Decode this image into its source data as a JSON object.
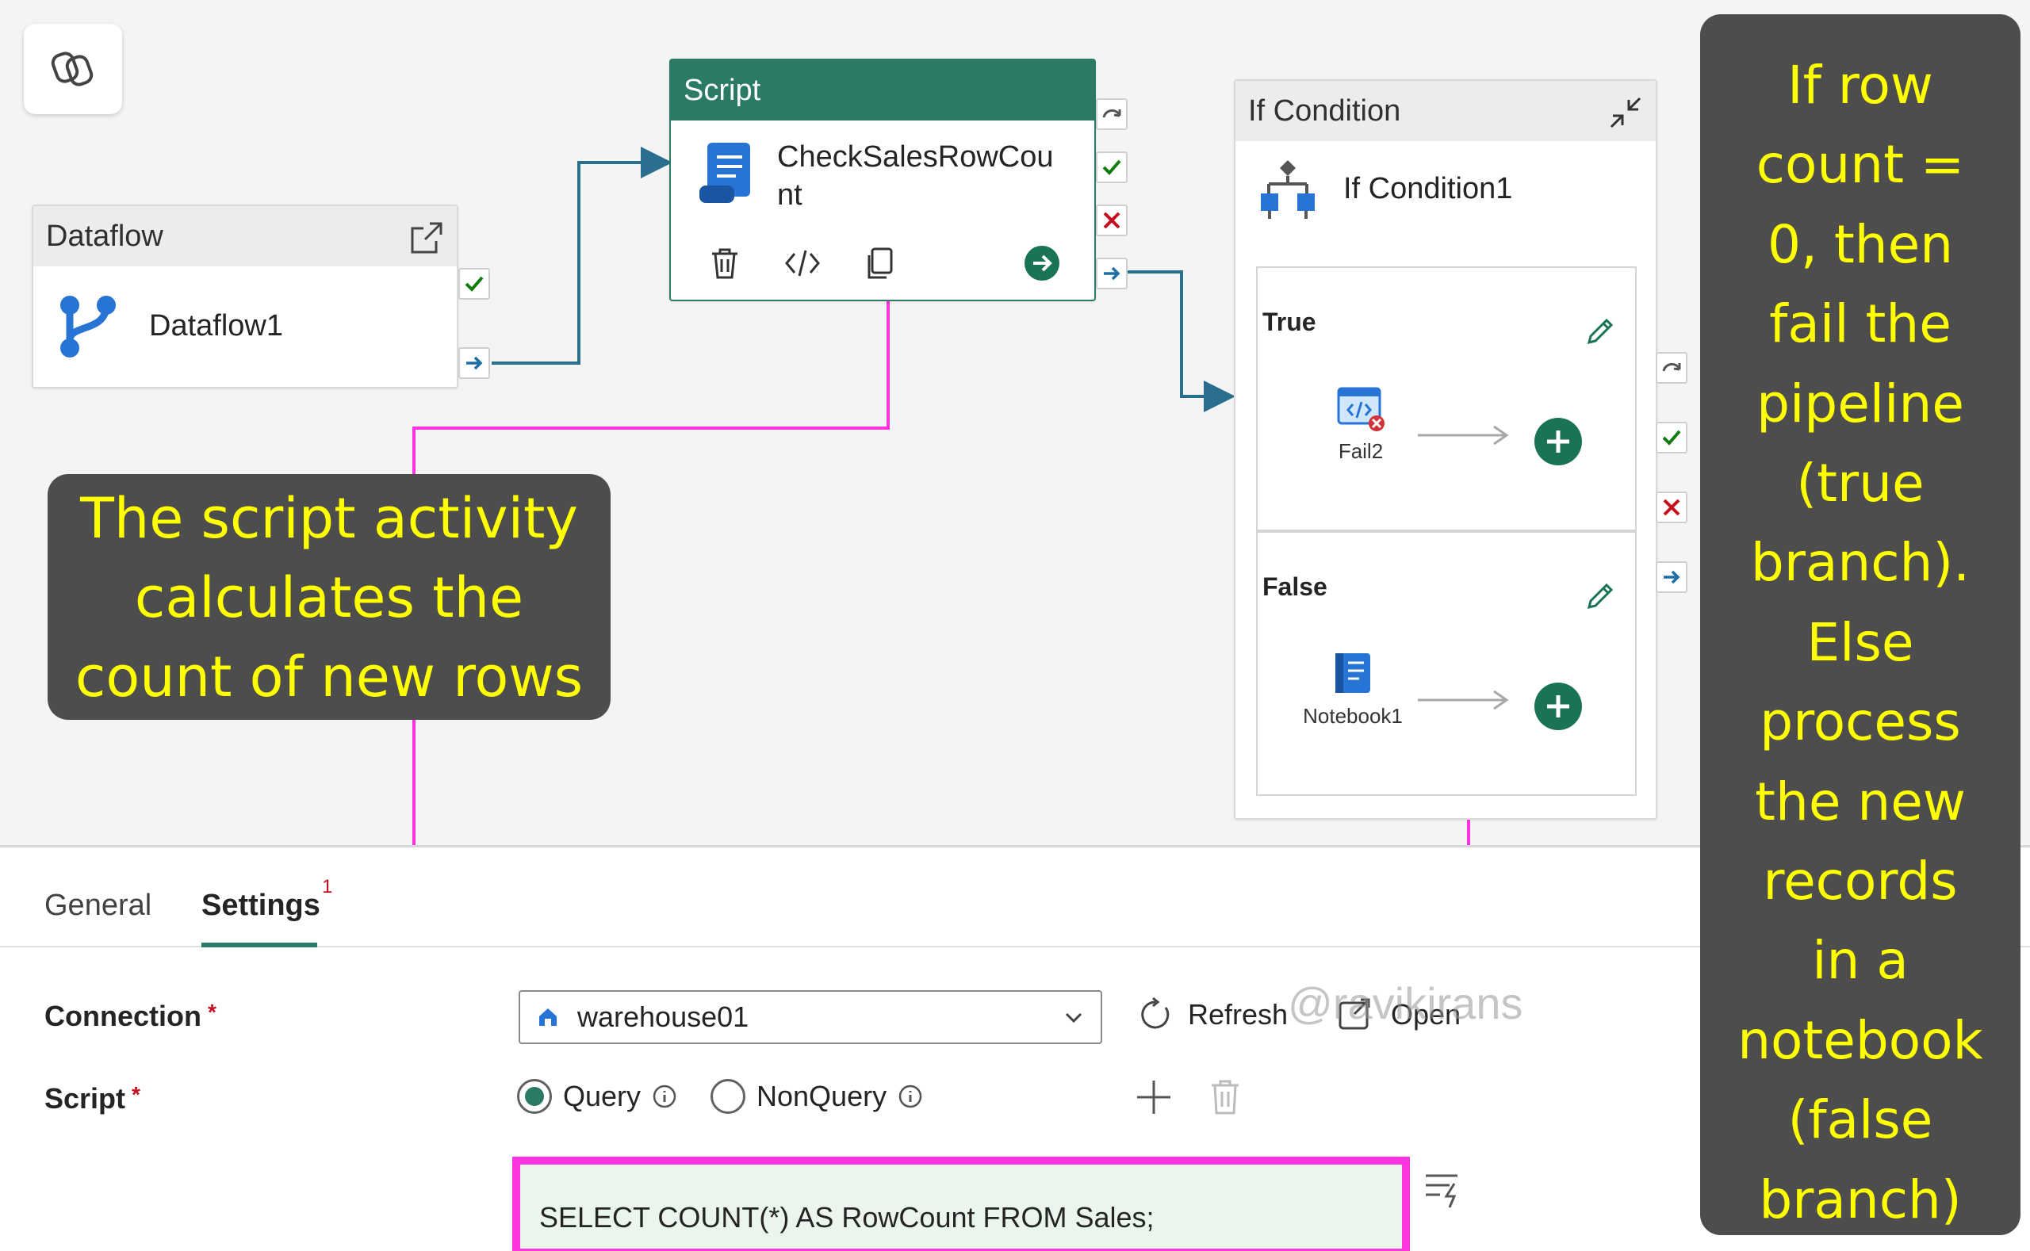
{
  "activities": {
    "dataflow": {
      "header": "Dataflow",
      "name": "Dataflow1"
    },
    "script": {
      "header": "Script",
      "name_line1": "CheckSalesRowCou",
      "name_line2": "nt"
    },
    "if_condition": {
      "header": "If Condition",
      "name": "If Condition1",
      "true_branch": {
        "title": "True",
        "activity": "Fail2"
      },
      "false_branch": {
        "title": "False",
        "activity": "Notebook1"
      }
    }
  },
  "callouts": {
    "left": [
      "The script activity",
      "calculates the",
      "count of new rows"
    ],
    "right": [
      "If row",
      "count =",
      "0, then",
      "fail the",
      "pipeline",
      "(true",
      "branch).",
      "Else",
      "process",
      "the new",
      "records",
      "in a",
      "notebook",
      "(false",
      "branch)"
    ]
  },
  "tabs": {
    "general": "General",
    "settings": "Settings",
    "settings_badge": "1"
  },
  "settings": {
    "connection_label": "Connection",
    "connection_value": "warehouse01",
    "refresh": "Refresh",
    "open": "Open",
    "script_label": "Script",
    "required_mark": "*",
    "query_label": "Query",
    "nonquery_label": "NonQuery",
    "query_text": "SELECT COUNT(*) AS RowCount FROM Sales;"
  },
  "watermark": "@ravikirans",
  "colors": {
    "accent": "#2b7a66",
    "callout_text": "#ffff00",
    "callout_bg": "#4d4d4d",
    "pointer": "#ff33dd",
    "connector": "#2b6f8f"
  }
}
